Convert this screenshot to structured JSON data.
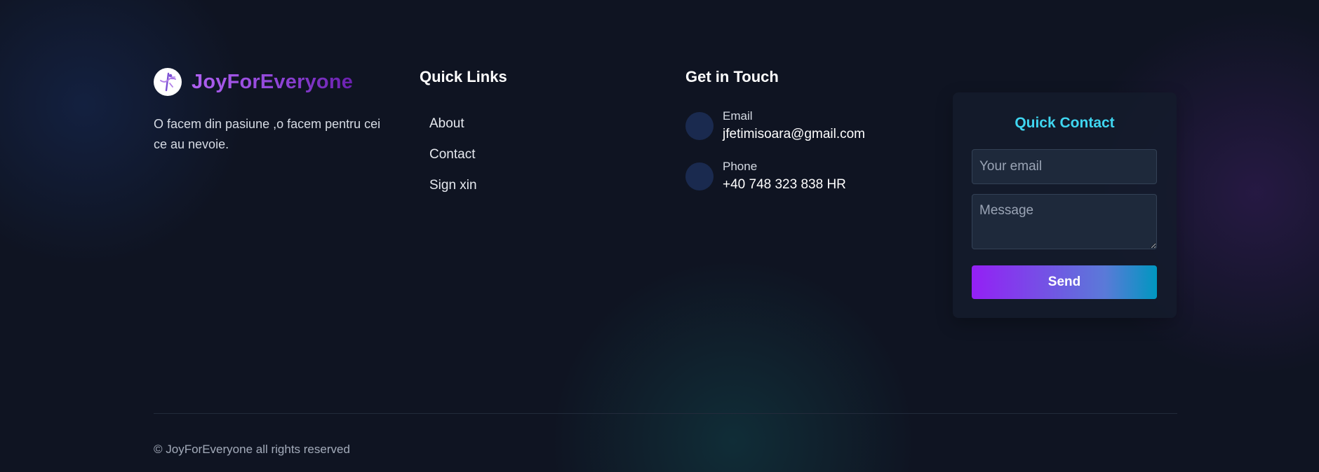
{
  "brand": {
    "name": "JoyForEveryone",
    "description": "O facem din pasiune ,o facem pentru cei ce au nevoie.",
    "logo_icon": "dancer-logo-icon",
    "gradient_colors": [
      "#b061f2",
      "#6a1fae"
    ]
  },
  "quick_links": {
    "title": "Quick Links",
    "items": [
      {
        "label": "About"
      },
      {
        "label": "Contact"
      },
      {
        "label": "Sign xin"
      }
    ]
  },
  "get_in_touch": {
    "title": "Get in Touch",
    "email": {
      "label": "Email",
      "value": "jfetimisoara@gmail.com"
    },
    "phone": {
      "label": "Phone",
      "value": "+40 748 323 838 HR"
    }
  },
  "quick_contact": {
    "title": "Quick Contact",
    "email_placeholder": "Your email",
    "email_value": "",
    "message_placeholder": "Message",
    "message_value": "",
    "send_label": "Send",
    "title_color": "#3fd6f0",
    "button_gradient": [
      "#9420f5",
      "#0097c0"
    ]
  },
  "footer": {
    "copyright": "© JoyForEveryone all rights reserved"
  }
}
